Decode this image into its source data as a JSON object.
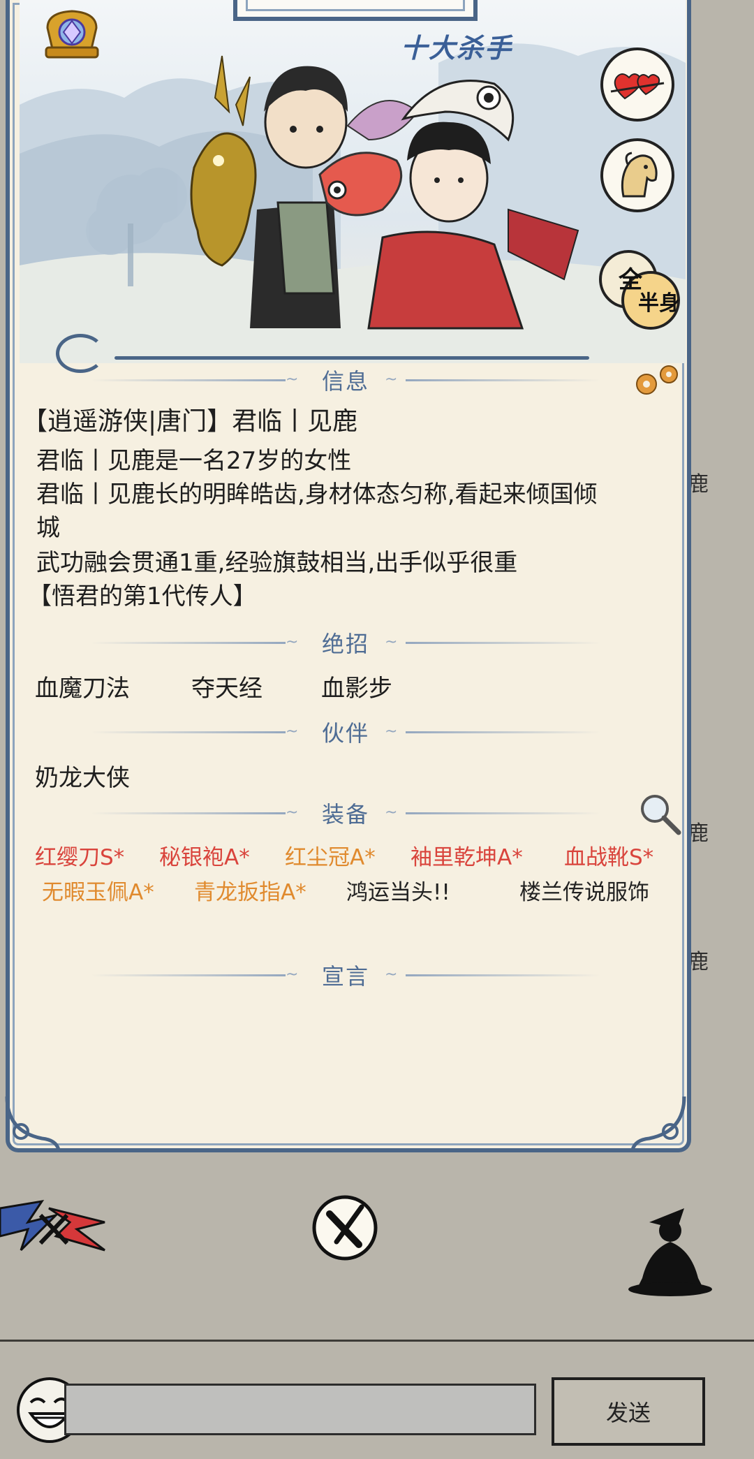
{
  "header": {
    "title_tag": "十大杀手",
    "body_toggle": "全半身"
  },
  "background": {
    "side_chars": [
      "鹿",
      "鹿",
      "鹿"
    ]
  },
  "sections": {
    "info": "信息",
    "skills": "绝招",
    "partner": "伙伴",
    "equipment": "装备",
    "declaration": "宣言"
  },
  "info": {
    "name_line": "【逍遥游侠|唐门】君临丨见鹿",
    "line1": "君临丨见鹿是一名27岁的女性",
    "line2a": "君临丨见鹿长的明眸皓齿,身材体态匀称,看起来倾国倾",
    "line2b": "城",
    "line3": "武功融会贯通1重,经验旗鼓相当,出手似乎很重",
    "line4": "【悟君的第1代传人】"
  },
  "skills": [
    "血魔刀法",
    "夺天经",
    "血影步"
  ],
  "partner": "奶龙大侠",
  "equipment": {
    "row1": [
      {
        "text": "红缨刀S*",
        "color": "red"
      },
      {
        "text": "秘银袍A*",
        "color": "red"
      },
      {
        "text": "红尘冠A*",
        "color": "orange"
      },
      {
        "text": "袖里乾坤A*",
        "color": "red"
      },
      {
        "text": "血战靴S*",
        "color": "red"
      }
    ],
    "row2": [
      {
        "text": "无暇玉佩A*",
        "color": "orange"
      },
      {
        "text": "青龙扳指A*",
        "color": "orange"
      },
      {
        "text": "鸿运当头!!",
        "color": "dark"
      },
      {
        "text": "楼兰传说服饰",
        "color": "dark"
      }
    ]
  },
  "chat": {
    "send_label": "发送",
    "input_placeholder": ""
  },
  "colors": {
    "card_border": "#4a6587",
    "card_bg": "#f6f0e1",
    "section_label": "#4e6c94",
    "equip_red": "#d9443c",
    "equip_orange": "#e08a2e",
    "page_bg": "#b9b5ab"
  }
}
